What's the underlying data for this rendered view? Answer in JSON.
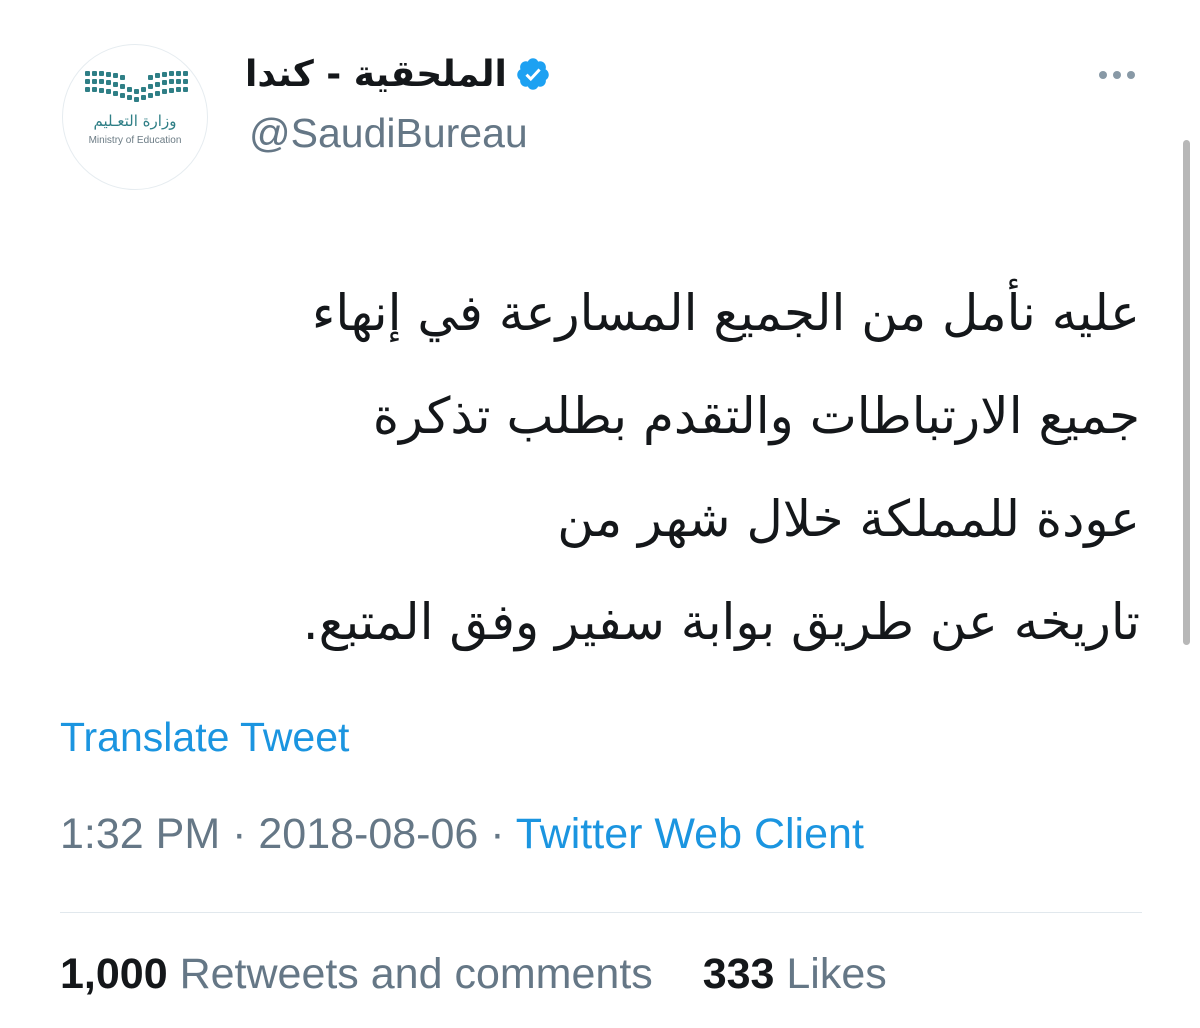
{
  "account": {
    "display_name": "الملحقية - كندا",
    "handle": "@SaudiBureau",
    "verified_icon": "verified-badge-icon",
    "avatar": {
      "logo_text_ar": "وزارة التعـليم",
      "logo_text_en": "Ministry of Education",
      "logo_color": "#2f7f86"
    }
  },
  "more_icon": "more-dots-icon",
  "tweet": {
    "lines": [
      "عليه نأمل من الجميع المسارعة في إنهاء",
      "جميع الارتباطات والتقدم بطلب تذكرة",
      "عودة للمملكة خلال شهر من",
      "تاريخه عن طريق بوابة سفير وفق المتبع."
    ]
  },
  "translate_label": "Translate Tweet",
  "meta": {
    "time": "1:32 PM",
    "separator": "·",
    "date": "2018-08-06",
    "source": "Twitter Web Client"
  },
  "stats": {
    "retweets_count": "1,000",
    "retweets_label": "Retweets and comments",
    "likes_count": "333",
    "likes_label": "Likes"
  },
  "colors": {
    "link": "#1b95e0",
    "verified": "#1da1f2",
    "secondary_text": "#657786",
    "primary_text": "#14171a"
  }
}
